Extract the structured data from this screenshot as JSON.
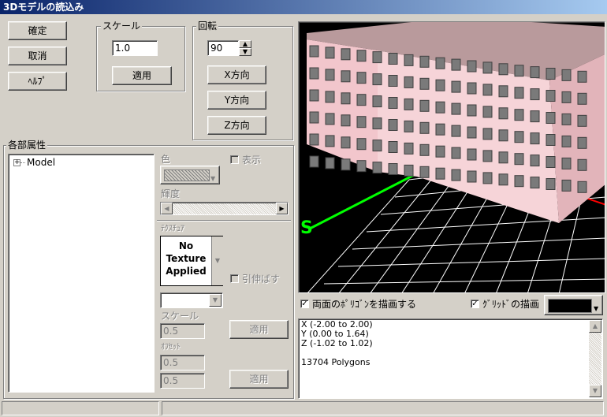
{
  "window": {
    "title": "3Dモデルの読込み"
  },
  "buttons": {
    "ok": "確定",
    "cancel": "取消",
    "help": "ﾍﾙﾌﾟ"
  },
  "scale": {
    "label": "スケール",
    "value": "1.0",
    "apply": "適用"
  },
  "rotate": {
    "label": "回転",
    "value": "90",
    "x": "X方向",
    "y": "Y方向",
    "z": "Z方向"
  },
  "parts": {
    "label": "各部属性",
    "tree_items": [
      "Model"
    ],
    "color_label": "色",
    "show_label": "表示",
    "brightness_label": "輝度",
    "texture_label": "ﾃｸｽﾁｭｱ",
    "texture_placeholder": "No\nTexture\nApplied",
    "stretch_label": "引伸ばす",
    "scale_label": "スケール",
    "scale_value": "0.5",
    "apply1": "適用",
    "offset_label": "ｵﾌｾｯﾄ",
    "offset_x": "0.5",
    "offset_y": "0.5",
    "apply2": "適用"
  },
  "viewport": {
    "double_sided_label": "両面のﾎﾟﾘｺﾞﾝを描画する",
    "double_sided_checked": true,
    "grid_label": "ｸﾞﾘｯﾄﾞの描画",
    "grid_checked": true,
    "bg_color": "#000000"
  },
  "info": {
    "lines": [
      "X (-2.00 to 2.00)",
      "Y (0.00 to 1.64)",
      "Z (-1.02 to 1.02)",
      "",
      "13704 Polygons"
    ]
  },
  "colors": {
    "building": "#f2c6cc",
    "roof": "#b99a9c",
    "grid": "#ffffff",
    "axis_x": "#ff0000",
    "axis_y": "#0000ff",
    "axis_z": "#00ff00"
  }
}
